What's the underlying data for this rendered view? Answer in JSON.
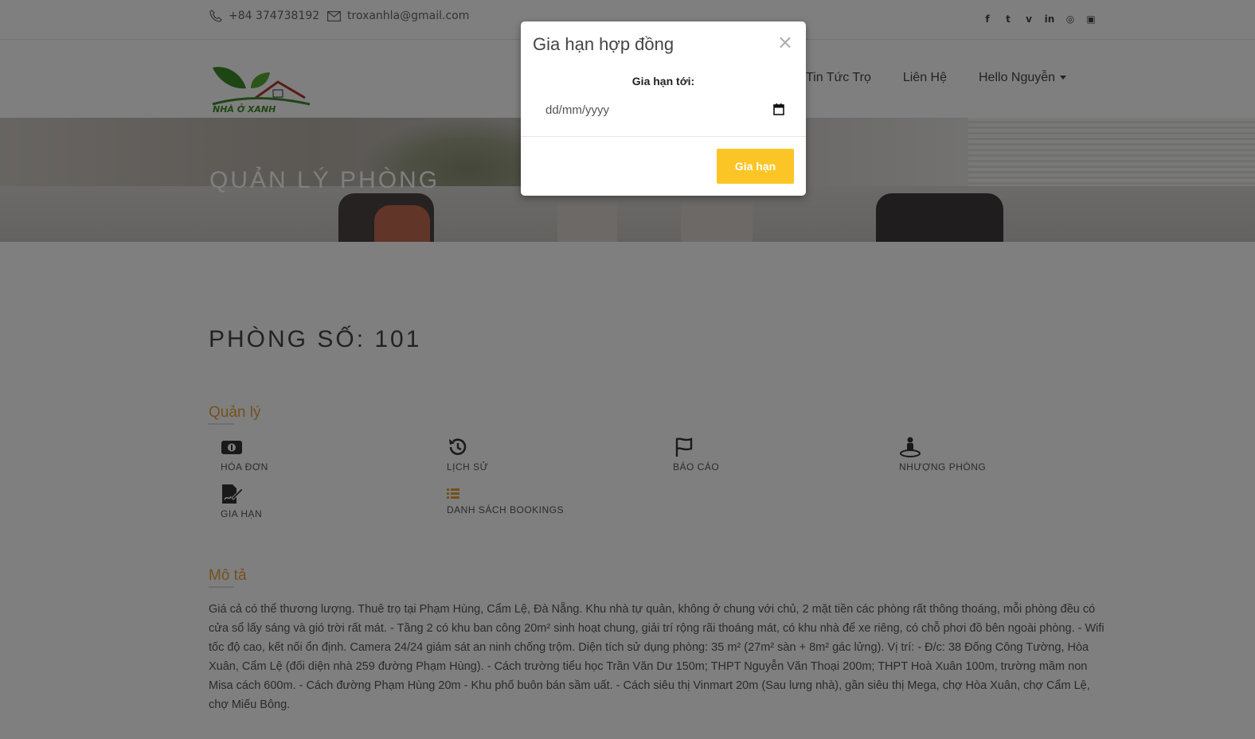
{
  "topbar": {
    "phone": "+84 374738192",
    "email": "troxanhla@gmail.com",
    "social_icons": [
      "facebook-icon",
      "twitter-icon",
      "vine-icon",
      "linkedin-icon",
      "dribbble-icon",
      "instagram-icon"
    ]
  },
  "logo": {
    "text": "NHÀ Ở XANH"
  },
  "nav": {
    "items": [
      {
        "label": "Tin Tức Trọ"
      },
      {
        "label": "Liên Hệ"
      },
      {
        "label": "Hello Nguyễn"
      }
    ]
  },
  "hero": {
    "title": "QUẢN LÝ PHÒNG"
  },
  "room": {
    "title": "PHÒNG SỐ: 101"
  },
  "manage": {
    "title": "Quản lý",
    "tiles": [
      {
        "label": "HÓA ĐƠN",
        "icon": "money-icon"
      },
      {
        "label": "LỊCH SỬ",
        "icon": "history-icon"
      },
      {
        "label": "BÁO CÁO",
        "icon": "flag-icon"
      },
      {
        "label": "NHƯỢNG PHÒNG",
        "icon": "transfer-person-icon"
      },
      {
        "label": "GIA HẠN",
        "icon": "sign-document-icon"
      },
      {
        "label": "DANH SÁCH BOOKINGS",
        "icon": "list-icon"
      }
    ]
  },
  "description": {
    "title": "Mô tả",
    "text": "Giá cả có thể thương lượng. Thuê trọ tại Phạm Hùng, Cẩm Lệ, Đà Nẵng. Khu nhà tự quản, không ở chung với chủ, 2 mặt tiền các phòng rất thông thoáng, mỗi phòng đều có cửa sổ lấy sáng và gió trời rất mát. - Tầng 2 có khu ban công 20m² sinh hoạt chung, giải trí rộng rãi thoáng mát, có khu nhà để xe riêng, có chỗ phơi đồ bên ngoài phòng. - Wifi tốc độ cao, kết nối ổn định. Camera 24/24 giám sát an ninh chống trộm. Diện tích sử dụng phòng: 35 m² (27m² sàn + 8m² gác lửng). Vị trí: - Đ/c: 38 Đống Công Tường, Hòa Xuân, Cẩm Lệ (đối diện nhà 259 đường Phạm Hùng). - Cách trường tiểu học Trần Văn Dư 150m; THPT Nguyễn Văn Thoại 200m; THPT Hoà Xuân 100m, trường mầm non Misa cách 600m. - Cách đường Phạm Hùng 20m - Khu phố buôn bán sầm uất. - Cách siêu thị Vinmart 20m (Sau lưng nhà), gần siêu thị Mega, chợ Hòa Xuân, chợ Cẩm Lệ, chợ Miếu Bông."
  },
  "modal": {
    "title": "Gia hạn hợp đồng",
    "close_label": "×",
    "field_label": "Gia hạn tới:",
    "date_placeholder": "dd/mm/yyyy",
    "submit_label": "Gia hạn"
  },
  "colors": {
    "accent_orange": "#e8a23a",
    "button_yellow": "#fcc526",
    "overlay": "rgba(0,0,0,0.5)"
  }
}
